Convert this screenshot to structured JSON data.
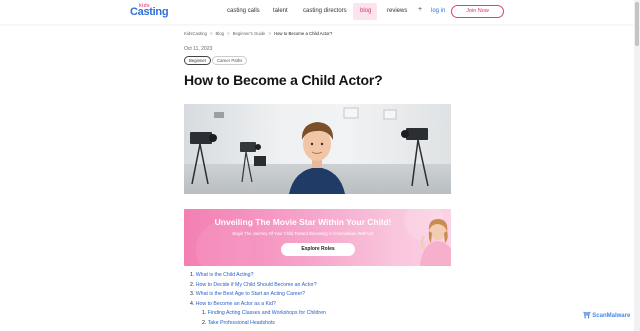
{
  "header": {
    "logo_kids": "kids",
    "logo_casting": "Casting",
    "nav": {
      "casting_calls": "casting calls",
      "talent": "talent",
      "casting_directors": "casting directors",
      "blog": "blog",
      "reviews": "reviews"
    },
    "plus": "+",
    "login": "log in",
    "join": "Join Now"
  },
  "breadcrumb": {
    "items": [
      "KidsCasting",
      "Blog",
      "Beginner's Guide",
      "How to Become a Child Actor?"
    ],
    "separator": ">"
  },
  "article": {
    "date": "Oct 11, 2023",
    "tags": [
      "Beginner",
      "Career Paths"
    ],
    "title": "How to Become a Child Actor?"
  },
  "banner": {
    "title": "Unveiling The Movie Star Within Your Child!",
    "subtitle": "Begin The Journey Of Your Child Toward Becoming A Cinematician With Us!",
    "button": "Explore Roles"
  },
  "toc": [
    {
      "num": "1.",
      "label": "What is the Child Acting?",
      "level": 1
    },
    {
      "num": "2.",
      "label": "How to Decide if My Child Should Become an Actor?",
      "level": 1
    },
    {
      "num": "3.",
      "label": "What is the Best Age to Start an Acting Career?",
      "level": 1
    },
    {
      "num": "4.",
      "label": "How to Become an Actor as a Kid?",
      "level": 1
    },
    {
      "num": "1.",
      "label": "Finding Acting Classes and Workshops for Children",
      "level": 2
    },
    {
      "num": "2.",
      "label": "Take Professional Headshots",
      "level": 2
    }
  ],
  "watermark": "ScanMalware",
  "colors": {
    "brand_pink": "#e23d7a",
    "brand_blue": "#2f6fd8",
    "link_blue": "#2a62c9"
  }
}
